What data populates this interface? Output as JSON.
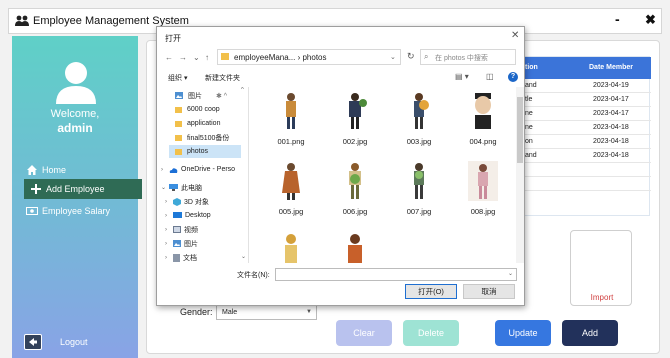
{
  "window": {
    "title": "Employee Management System",
    "minimize": "-",
    "close": "✖"
  },
  "sidebar": {
    "welcome": "Welcome,",
    "user": "admin",
    "items": [
      {
        "label": "Home",
        "icon": "home-icon"
      },
      {
        "label": "Add Employee",
        "icon": "plus-icon",
        "active": true
      },
      {
        "label": "Employee Salary",
        "icon": "salary-icon"
      }
    ],
    "logout": "Logout"
  },
  "table": {
    "headers": [
      "tion",
      "Date Member"
    ],
    "rows": [
      [
        "and",
        "2023-04-19"
      ],
      [
        "tle",
        "2023-04-17"
      ],
      [
        "ne",
        "2023-04-17"
      ],
      [
        "ne",
        "2023-04-18"
      ],
      [
        "on",
        "2023-04-18"
      ],
      [
        "and",
        "2023-04-18"
      ]
    ]
  },
  "form": {
    "gender_label": "Gender:",
    "gender_value": "Male",
    "import_label": "Import",
    "buttons": {
      "clear": "Clear",
      "delete": "Delete",
      "update": "Update",
      "add": "Add"
    }
  },
  "dialog": {
    "title": "打开",
    "close": "✕",
    "path": "employeeMana... › photos",
    "search_placeholder": "在 photos 中搜索",
    "toolbar": {
      "organize": "组织 ▾",
      "new_folder": "新建文件夹"
    },
    "tree": [
      {
        "label": "图片",
        "type": "pictures",
        "extra": "✱ ^"
      },
      {
        "label": "6000 coop",
        "type": "folder"
      },
      {
        "label": "application",
        "type": "folder"
      },
      {
        "label": "final5100备份",
        "type": "folder"
      },
      {
        "label": "photos",
        "type": "folder",
        "selected": true
      },
      {
        "label": "OneDrive - Perso",
        "type": "onedrive",
        "chevron": "›"
      },
      {
        "label": "此电脑",
        "type": "pc",
        "chevron": "⌄"
      },
      {
        "label": "3D 对象",
        "type": "objects3d",
        "chevron": "›"
      },
      {
        "label": "Desktop",
        "type": "desktop",
        "chevron": "›"
      },
      {
        "label": "视频",
        "type": "video",
        "chevron": "›"
      },
      {
        "label": "图片",
        "type": "pictures",
        "chevron": "›"
      },
      {
        "label": "文档",
        "type": "docs",
        "chevron": "›"
      }
    ],
    "files": [
      "001.png",
      "002.jpg",
      "003.jpg",
      "004.png",
      "005.jpg",
      "006.jpg",
      "007.jpg",
      "008.jpg",
      "",
      ""
    ],
    "filename_label": "文件名(N):",
    "filename_value": "",
    "open_button": "打开(O)",
    "cancel_button": "取消"
  },
  "colors": {
    "sidebar_top": "#5fd0c7",
    "sidebar_bottom": "#89a3e6",
    "active_nav": "#2f6b55",
    "table_header": "#3b74d9",
    "clear": "#b9c2ee",
    "delete": "#9ee3d4",
    "update": "#3677e0",
    "add": "#22315b",
    "import_text": "#d04040"
  }
}
